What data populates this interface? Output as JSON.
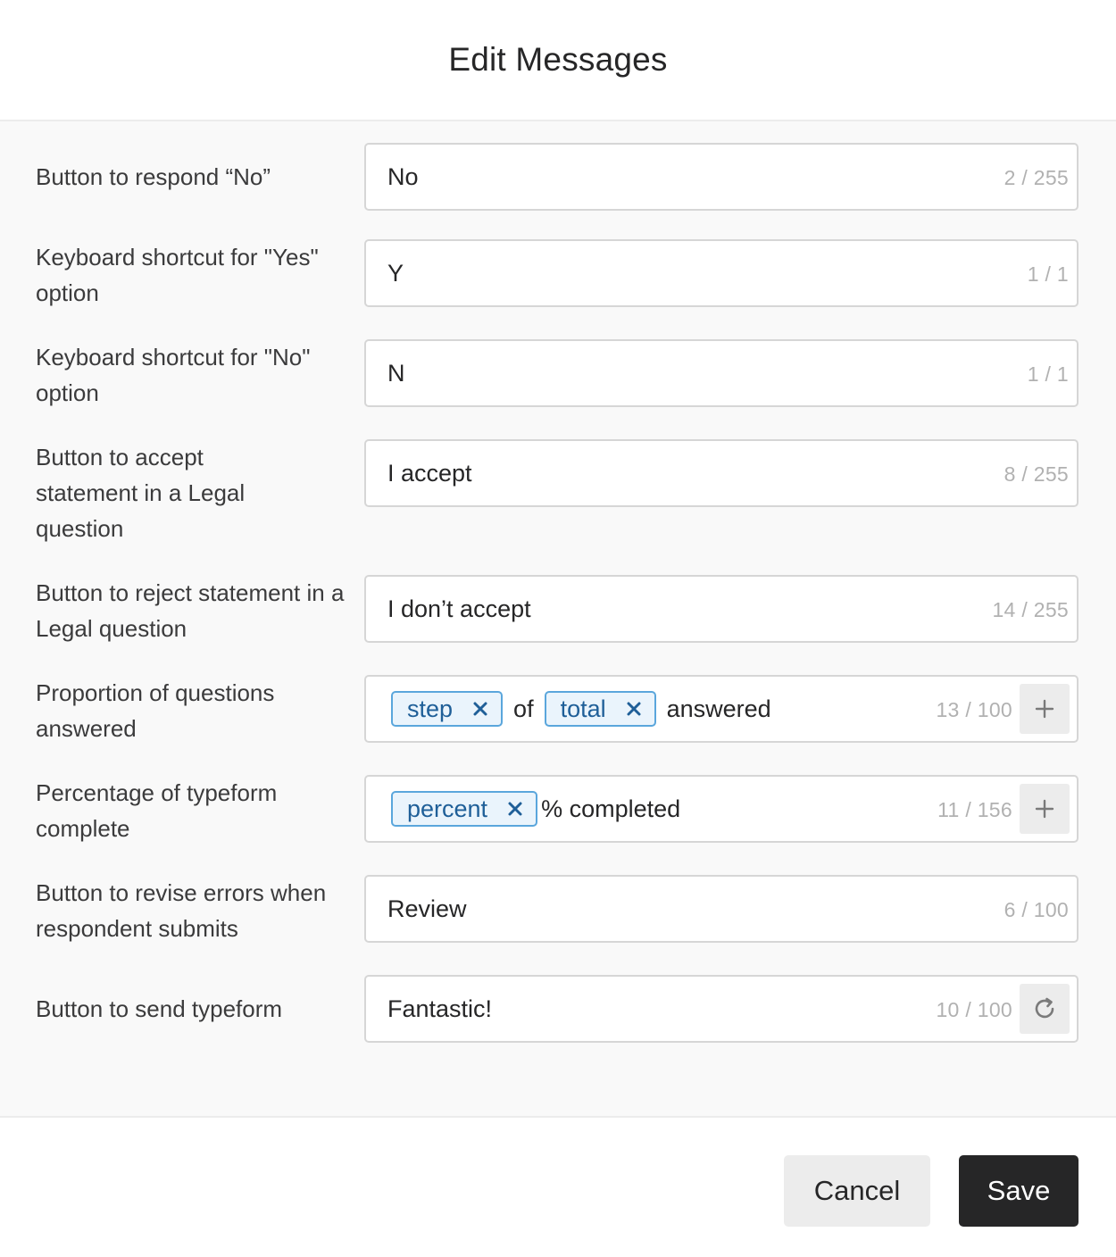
{
  "header": {
    "title": "Edit Messages"
  },
  "rows": [
    {
      "label": "Button to respond “No”",
      "value": "No",
      "counter": "2 / 255"
    },
    {
      "label": "Keyboard shortcut for \"Yes\" option",
      "value": "Y",
      "counter": "1 / 1"
    },
    {
      "label": "Keyboard shortcut for \"No\" option",
      "value": "N",
      "counter": "1 / 1"
    },
    {
      "label": "Button to accept statement in a Legal question",
      "value": "I accept",
      "counter": "8 / 255"
    },
    {
      "label": "Button to reject statement in a Legal question",
      "value": "I don’t accept",
      "counter": "14 / 255"
    },
    {
      "label": "Proportion of questions answered",
      "tokens": {
        "chip1": "step",
        "text1": "of",
        "chip2": "total",
        "text2": "answered"
      },
      "counter": "13 / 100",
      "button_icon": "plus-icon"
    },
    {
      "label": "Percentage of typeform complete",
      "tokens": {
        "chip1": "percent",
        "text1": "% completed"
      },
      "counter": "11 / 156",
      "button_icon": "plus-icon"
    },
    {
      "label": "Button to revise errors when respondent submits",
      "value": "Review",
      "counter": "6 / 100"
    },
    {
      "label": "Button to send typeform",
      "value": "Fantastic!",
      "counter": "10 / 100",
      "button_icon": "reset-icon"
    }
  ],
  "footer": {
    "cancel_label": "Cancel",
    "save_label": "Save"
  },
  "colors": {
    "chip_border": "#5aa6dc",
    "chip_bg": "#eaf4fc",
    "chip_text": "#1f5f98",
    "save_bg": "#262627",
    "body_bg": "#f9f9f9"
  }
}
